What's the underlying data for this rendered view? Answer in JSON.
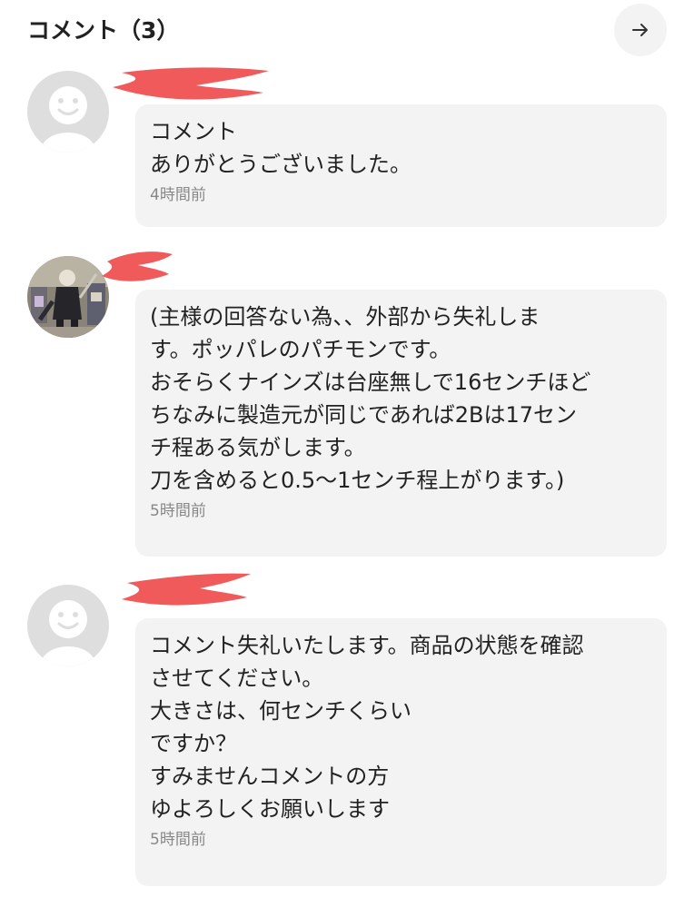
{
  "header": {
    "title": "コメント（3）",
    "next_icon": "arrow-right-icon"
  },
  "colors": {
    "bubble_bg": "#f3f3f3",
    "redaction": "#f05a5a",
    "timestamp": "#888888"
  },
  "comments": [
    {
      "avatar": "default-avatar-icon",
      "text": "コメント\nありがとうございました。",
      "time": "4時間前"
    },
    {
      "avatar": "photo-avatar",
      "text": "(主様の回答ない為、、外部から失礼しま\nす。ポッパレのパチモンです。\nおそらくナインズは台座無しで16センチほど\nちなみに製造元が同じであれば2Bは17セン\nチ程ある気がします。\n刀を含めると0.5〜1センチ程上がります。)",
      "time": "5時間前"
    },
    {
      "avatar": "default-avatar-icon",
      "text": "コメント失礼いたします。商品の状態を確認\nさせてください。\n大きさは、何センチくらい\nですか？\nすみませんコメントの方\nゆよろしくお願いします",
      "time": "5時間前"
    }
  ]
}
